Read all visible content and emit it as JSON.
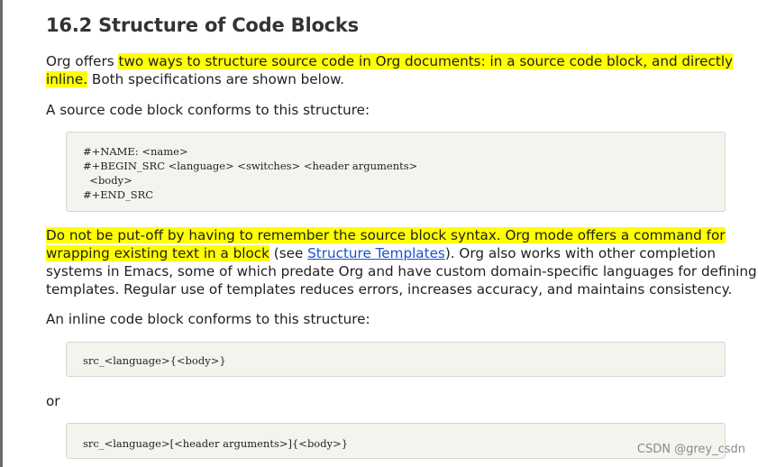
{
  "section": {
    "title": "16.2 Structure of Code Blocks"
  },
  "intro": {
    "lead": "Org offers ",
    "highlight_line1": "two ways to structure source code in Org documents: in a source code block, and directly",
    "highlight_line2": "inline.",
    "tail": " Both specifications are shown below."
  },
  "block_intro": "A source code block conforms to this structure:",
  "src_block": {
    "lines": [
      "#+NAME: <name>",
      "#+BEGIN_SRC <language> <switches> <header arguments>",
      "  <body>",
      "#+END_SRC"
    ]
  },
  "reminder": {
    "highlight_line1": "Do not be put-off by having to remember the source block syntax. Org mode offers a command for",
    "highlight_line2": "wrapping existing text in a block",
    "see_open": " (see ",
    "link_text": "Structure Templates",
    "after_link": "). Org also works with other completion",
    "line3": "systems in Emacs, some of which predate Org and have custom domain-specific languages for defining",
    "line4": "templates. Regular use of templates reduces errors, increases accuracy, and maintains consistency."
  },
  "inline_intro": "An inline code block conforms to this structure:",
  "inline_block_1": "src_<language>{<body>}",
  "or_text": "or",
  "inline_block_2": "src_<language>[<header arguments>]{<body>}",
  "watermark": "CSDN @grey_csdn"
}
